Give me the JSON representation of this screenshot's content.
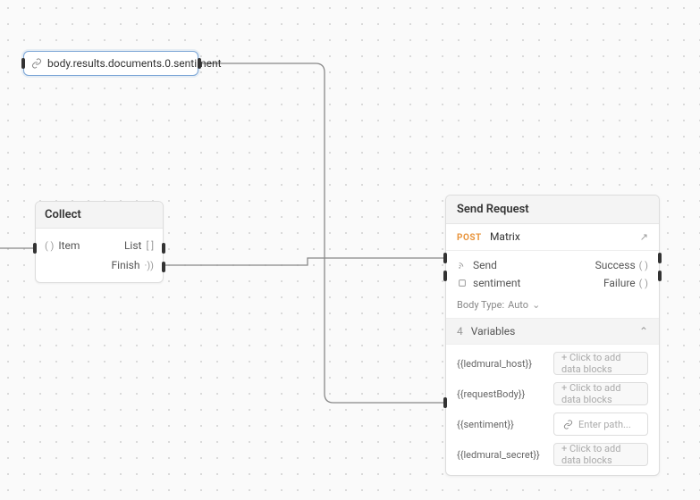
{
  "pathInput": {
    "value": "body.results.documents.0.sentiment"
  },
  "collect": {
    "title": "Collect",
    "item_label": "Item",
    "item_type": "( )",
    "list_label": "List",
    "list_type": "[ ]",
    "finish_label": "Finish",
    "finish_type": "·))"
  },
  "sendRequest": {
    "title": "Send Request",
    "method": "POST",
    "endpoint": "Matrix",
    "send_label": "Send",
    "sentiment_label": "sentiment",
    "success_label": "Success",
    "success_type": "( )",
    "failure_label": "Failure",
    "failure_type": "( )",
    "bodyType_label": "Body Type:",
    "bodyType_value": "Auto",
    "vars_count": "4",
    "vars_label": "Variables",
    "vars": [
      {
        "key": "{{ledmural_host}}",
        "placeholder": "+ Click to add data blocks",
        "active": false
      },
      {
        "key": "{{requestBody}}",
        "placeholder": "+ Click to add data blocks",
        "active": false
      },
      {
        "key": "{{sentiment}}",
        "placeholder": "Enter path...",
        "active": true
      },
      {
        "key": "{{ledmural_secret}}",
        "placeholder": "+ Click to add data blocks",
        "active": false
      }
    ]
  }
}
